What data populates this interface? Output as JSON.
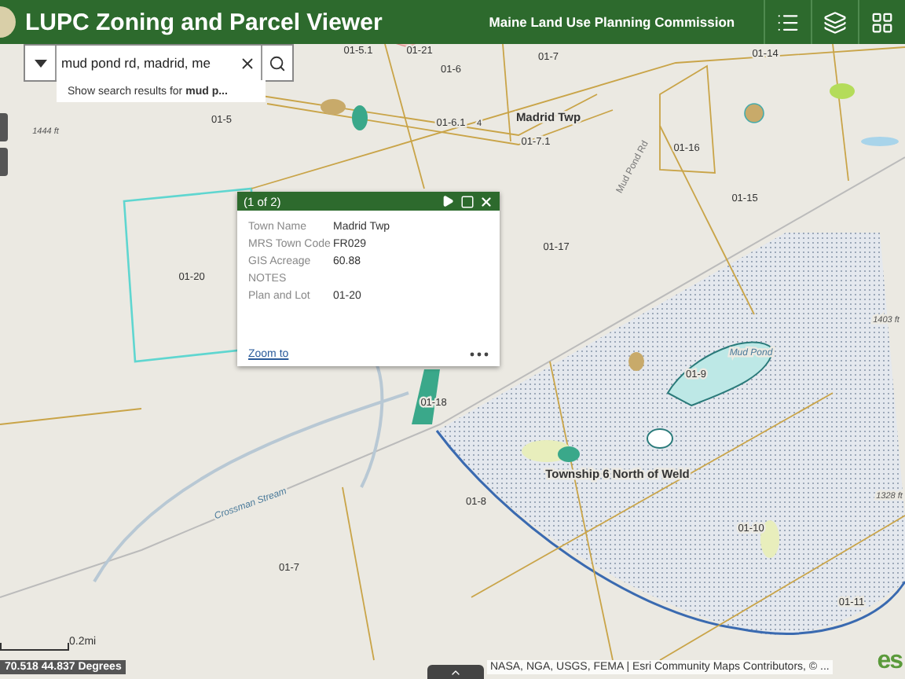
{
  "header": {
    "title": "LUPC Zoning and Parcel Viewer",
    "subtitle": "Maine Land Use Planning Commission",
    "tools": [
      {
        "kind": "list"
      },
      {
        "kind": "layers"
      },
      {
        "kind": "grid"
      }
    ]
  },
  "search": {
    "value": "mud pond rd, madrid, me",
    "suggestion": "Show search results for **mud p...**"
  },
  "popup": {
    "title": "(1 of 2)",
    "fields": [
      {
        "label": "Town Name",
        "value": "Madrid Twp"
      },
      {
        "label": "MRS Town Code",
        "value": "FR029"
      },
      {
        "label": "GIS Acreage",
        "value": "60.88"
      },
      {
        "label": "NOTES"
      },
      {
        "label": "Plan and Lot",
        "value": "01-20"
      }
    ],
    "link": "Zoom to"
  },
  "map": {
    "labels": [
      {
        "text": "01-5.1",
        "kind": "parcel"
      },
      {
        "text": "01-21",
        "kind": "parcel"
      },
      {
        "text": "01-6",
        "kind": "parcel"
      },
      {
        "text": "01-7",
        "kind": "parcel"
      },
      {
        "text": "01-14",
        "kind": "parcel"
      },
      {
        "text": "01-5",
        "kind": "parcel"
      },
      {
        "text": "01-6.1",
        "kind": "parcel"
      },
      {
        "text": "4",
        "kind": "shield"
      },
      {
        "text": "Madrid Twp",
        "kind": "place"
      },
      {
        "text": "01-7.1",
        "kind": "parcel"
      },
      {
        "text": "Mud Pond Rd",
        "kind": "road"
      },
      {
        "text": "01-16",
        "kind": "parcel"
      },
      {
        "text": "01-15",
        "kind": "parcel"
      },
      {
        "text": "01-20",
        "kind": "parcel"
      },
      {
        "text": "01-17",
        "kind": "parcel"
      },
      {
        "text": "1444 ft",
        "kind": "elevation"
      },
      {
        "text": "1403 ft",
        "kind": "elevation"
      },
      {
        "text": "Mud Pond",
        "kind": "water"
      },
      {
        "text": "01-9",
        "kind": "parcel"
      },
      {
        "text": "01-18",
        "kind": "parcel"
      },
      {
        "text": "Township 6 North of Weld",
        "kind": "place"
      },
      {
        "text": "01-8",
        "kind": "parcel"
      },
      {
        "text": "Crossman Stream",
        "kind": "water"
      },
      {
        "text": "01-7",
        "kind": "parcel"
      },
      {
        "text": "01-10",
        "kind": "parcel"
      },
      {
        "text": "01-11",
        "kind": "parcel"
      },
      {
        "text": "1328 ft",
        "kind": "elevation"
      }
    ]
  },
  "scale": "0.2mi",
  "coordinates": "70.518 44.837 Degrees",
  "attribution": "NASA, NGA, USGS, FEMA | Esri Community Maps Contributors, © ...",
  "logo": "es"
}
